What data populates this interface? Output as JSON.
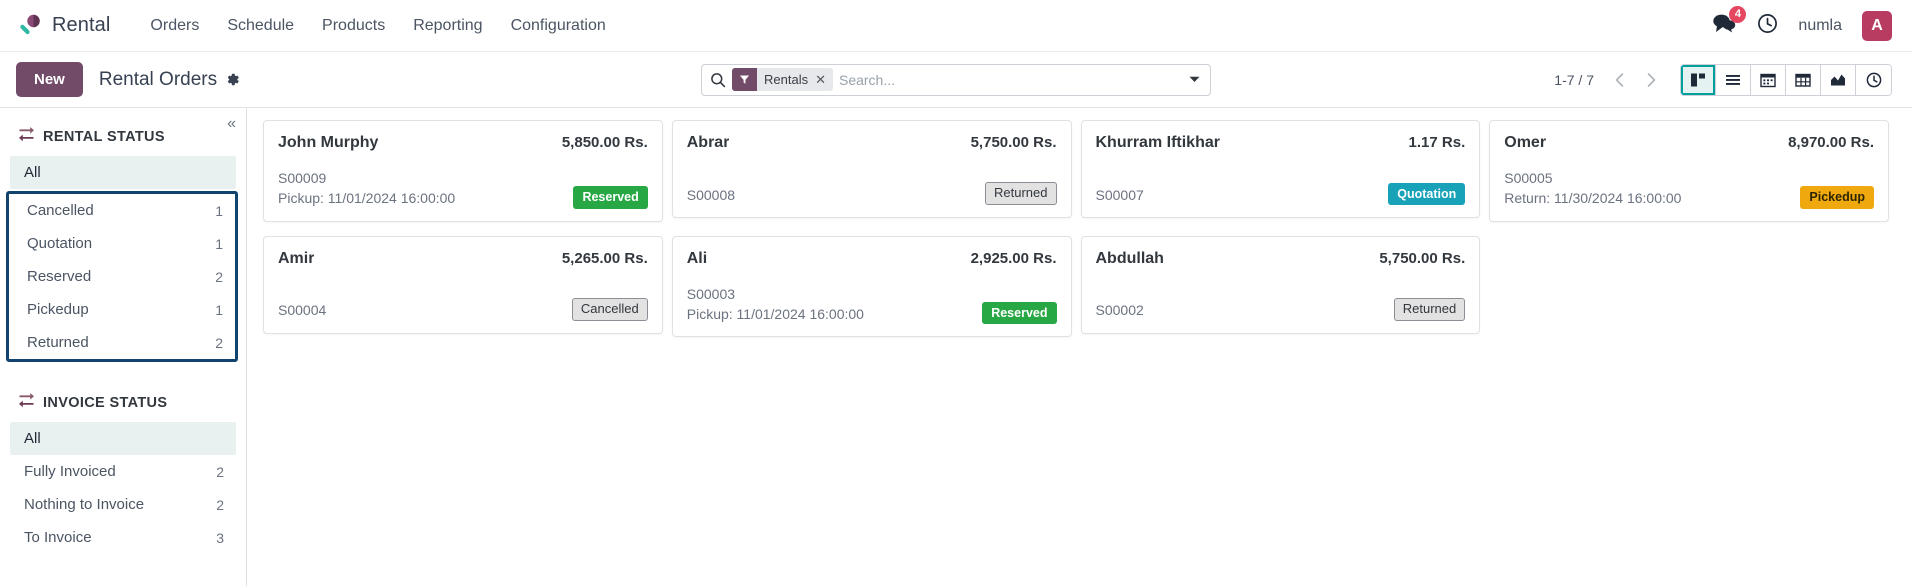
{
  "navbar": {
    "brand": "Rental",
    "brand_icon": "rental-key-icon",
    "menu": [
      "Orders",
      "Schedule",
      "Products",
      "Reporting",
      "Configuration"
    ],
    "messages_icon": "messages-icon",
    "messages_count": "4",
    "activity_icon": "clock-activity-icon",
    "user_name": "numla",
    "avatar_initial": "A"
  },
  "control_panel": {
    "new_label": "New",
    "title": "Rental Orders",
    "settings_icon": "gear-icon",
    "search": {
      "search_icon": "search-icon",
      "facet_icon": "filter-funnel-icon",
      "facet_label": "Rentals",
      "facet_remove_icon": "close-icon",
      "placeholder": "Search...",
      "value": "",
      "dropdown_icon": "chevron-down-icon"
    },
    "pager": {
      "value": "1-7 / 7",
      "prev_icon": "chevron-left-icon",
      "next_icon": "chevron-right-icon"
    },
    "views": [
      {
        "name": "kanban",
        "icon": "kanban-icon",
        "active": true
      },
      {
        "name": "list",
        "icon": "list-icon",
        "active": false
      },
      {
        "name": "calendar",
        "icon": "calendar-icon",
        "active": false
      },
      {
        "name": "pivot",
        "icon": "pivot-table-icon",
        "active": false
      },
      {
        "name": "graph",
        "icon": "graph-area-icon",
        "active": false
      },
      {
        "name": "activity",
        "icon": "clock-icon",
        "active": false
      }
    ]
  },
  "sidebar": {
    "collapse_icon": "chevrons-left-icon",
    "rental_status": {
      "icon": "exchange-arrows-icon",
      "title": "RENTAL STATUS",
      "all_label": "All",
      "items": [
        {
          "label": "Cancelled",
          "count": "1"
        },
        {
          "label": "Quotation",
          "count": "1"
        },
        {
          "label": "Reserved",
          "count": "2"
        },
        {
          "label": "Pickedup",
          "count": "1"
        },
        {
          "label": "Returned",
          "count": "2"
        }
      ]
    },
    "invoice_status": {
      "icon": "exchange-arrows-icon",
      "title": "INVOICE STATUS",
      "all_label": "All",
      "items": [
        {
          "label": "Fully Invoiced",
          "count": "2"
        },
        {
          "label": "Nothing to Invoice",
          "count": "2"
        },
        {
          "label": "To Invoice",
          "count": "3"
        }
      ]
    }
  },
  "kanban": {
    "cards": [
      {
        "name": "John Murphy",
        "amount": "5,850.00 Rs.",
        "reference": "S00009",
        "date": "Pickup: 11/01/2024 16:00:00",
        "state": "Reserved",
        "state_class": "state-reserved"
      },
      {
        "name": "Abrar",
        "amount": "5,750.00 Rs.",
        "reference": "S00008",
        "date": "",
        "state": "Returned",
        "state_class": "state-returned"
      },
      {
        "name": "Khurram Iftikhar",
        "amount": "1.17 Rs.",
        "reference": "S00007",
        "date": "",
        "state": "Quotation",
        "state_class": "state-quotation"
      },
      {
        "name": "Omer",
        "amount": "8,970.00 Rs.",
        "reference": "S00005",
        "date": "Return: 11/30/2024 16:00:00",
        "state": "Pickedup",
        "state_class": "state-pickedup"
      },
      {
        "name": "Amir",
        "amount": "5,265.00 Rs.",
        "reference": "S00004",
        "date": "",
        "state": "Cancelled",
        "state_class": "state-cancelled"
      },
      {
        "name": "Ali",
        "amount": "2,925.00 Rs.",
        "reference": "S00003",
        "date": "Pickup: 11/01/2024 16:00:00",
        "state": "Reserved",
        "state_class": "state-reserved"
      },
      {
        "name": "Abdullah",
        "amount": "5,750.00 Rs.",
        "reference": "S00002",
        "date": "",
        "state": "Returned",
        "state_class": "state-returned"
      }
    ]
  },
  "colors": {
    "brand_purple": "#714b67",
    "accent_teal": "#00a09d",
    "annotation_blue": "#11436f",
    "badge_red": "#e4475f",
    "avatar_pink": "#b83b62",
    "state_reserved": "#28a745",
    "state_quotation": "#17a2b8",
    "state_pickedup": "#efa80d",
    "state_muted": "#e2e2e2"
  }
}
